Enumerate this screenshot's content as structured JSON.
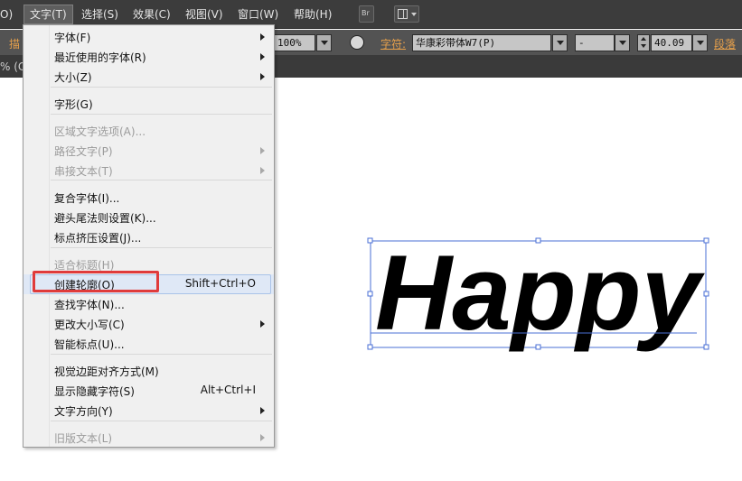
{
  "menubar": {
    "items": [
      {
        "label": "O)"
      },
      {
        "label": "文字(T)"
      },
      {
        "label": "选择(S)"
      },
      {
        "label": "效果(C)"
      },
      {
        "label": "视图(V)"
      },
      {
        "label": "窗口(W)"
      },
      {
        "label": "帮助(H)"
      }
    ],
    "bridge_icon_text": "Br"
  },
  "controlbar": {
    "left_label": "描",
    "opacity_value": "100%",
    "char_label": "字符:",
    "font_family": "华康彩带体W7(P)",
    "font_style": "-",
    "font_size": "40.09",
    "para_label": "段落"
  },
  "doc_tab": {
    "label": "% (CM"
  },
  "menu": {
    "sections": [
      [
        {
          "label": "字体(F)",
          "shortcut": "",
          "submenu": true,
          "disabled": false
        },
        {
          "label": "最近使用的字体(R)",
          "shortcut": "",
          "submenu": true,
          "disabled": false
        },
        {
          "label": "大小(Z)",
          "shortcut": "",
          "submenu": true,
          "disabled": false
        }
      ],
      [
        {
          "label": "字形(G)",
          "shortcut": "",
          "submenu": false,
          "disabled": false
        }
      ],
      [
        {
          "label": "区域文字选项(A)...",
          "shortcut": "",
          "submenu": false,
          "disabled": true
        },
        {
          "label": "路径文字(P)",
          "shortcut": "",
          "submenu": true,
          "disabled": true
        },
        {
          "label": "串接文本(T)",
          "shortcut": "",
          "submenu": true,
          "disabled": true
        }
      ],
      [
        {
          "label": "复合字体(I)...",
          "shortcut": "",
          "submenu": false,
          "disabled": false
        },
        {
          "label": "避头尾法则设置(K)...",
          "shortcut": "",
          "submenu": false,
          "disabled": false
        },
        {
          "label": "标点挤压设置(J)...",
          "shortcut": "",
          "submenu": false,
          "disabled": false
        }
      ],
      [
        {
          "label": "适合标题(H)",
          "shortcut": "",
          "submenu": false,
          "disabled": true
        },
        {
          "label": "创建轮廓(O)",
          "shortcut": "Shift+Ctrl+O",
          "submenu": false,
          "disabled": false,
          "highlighted": true
        },
        {
          "label": "查找字体(N)...",
          "shortcut": "",
          "submenu": false,
          "disabled": false
        },
        {
          "label": "更改大小写(C)",
          "shortcut": "",
          "submenu": true,
          "disabled": false
        },
        {
          "label": "智能标点(U)...",
          "shortcut": "",
          "submenu": false,
          "disabled": false
        }
      ],
      [
        {
          "label": "视觉边距对齐方式(M)",
          "shortcut": "",
          "submenu": false,
          "disabled": false
        },
        {
          "label": "显示隐藏字符(S)",
          "shortcut": "Alt+Ctrl+I",
          "submenu": false,
          "disabled": false
        },
        {
          "label": "文字方向(Y)",
          "shortcut": "",
          "submenu": true,
          "disabled": false
        }
      ],
      [
        {
          "label": "旧版文本(L)",
          "shortcut": "",
          "submenu": true,
          "disabled": true
        }
      ]
    ]
  },
  "artwork": {
    "text": "Happy",
    "selection_color": "#4a6fd6",
    "text_color": "#000000"
  },
  "colors": {
    "menubar_bg": "#3c3c3c",
    "controlbar_bg": "#535353",
    "label_orange": "#e8a14b",
    "callout_red": "#e03b3b"
  }
}
